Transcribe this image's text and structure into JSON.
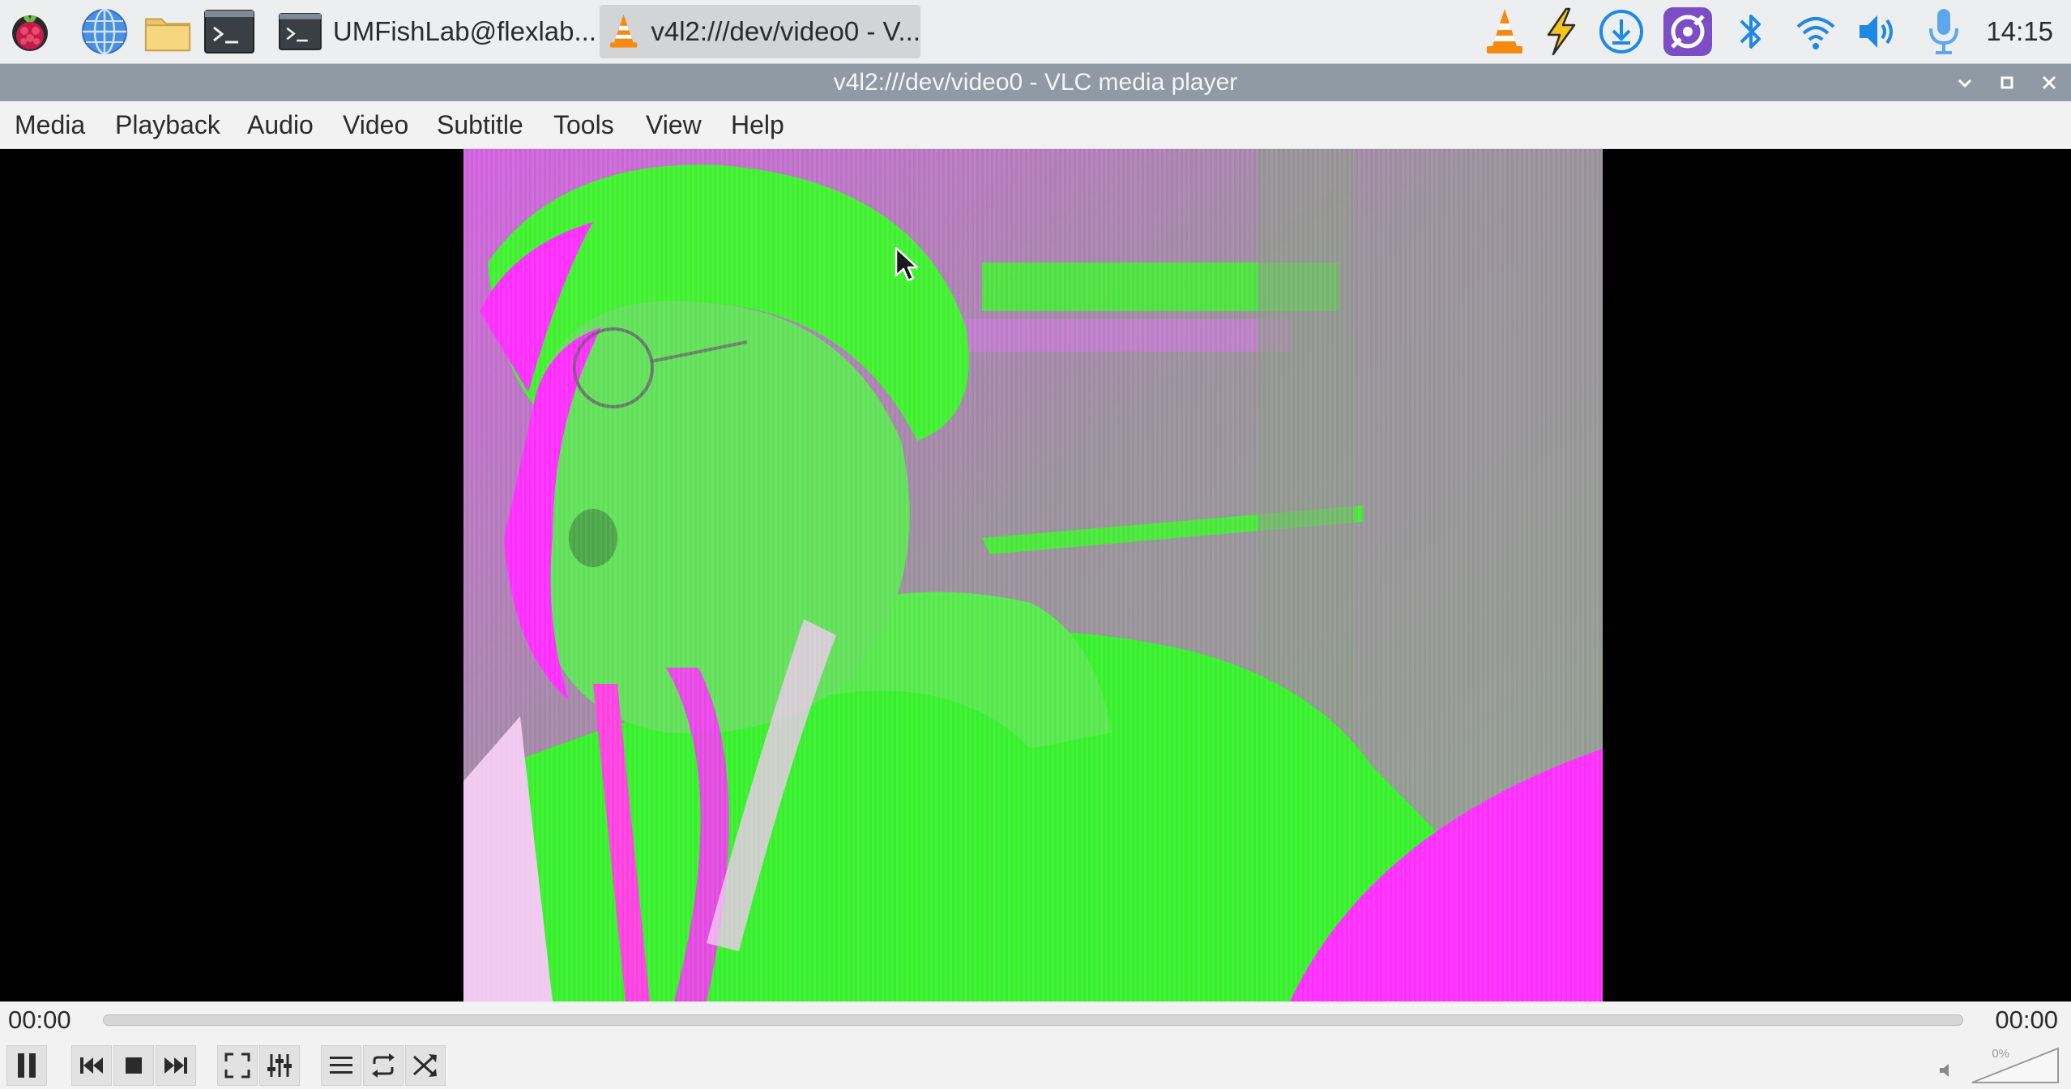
{
  "taskbar": {
    "launchers": [
      "raspberry-menu-icon",
      "web-browser-icon",
      "file-manager-icon",
      "terminal-icon"
    ],
    "tasks": [
      {
        "label": "UMFishLab@flexlab...",
        "icon": "terminal-icon",
        "active": false
      },
      {
        "label": "v4l2:///dev/video0 - V...",
        "icon": "vlc-cone-icon",
        "active": true
      }
    ],
    "tray": [
      "vlc-cone-icon",
      "lightning-bolt-icon",
      "download-icon",
      "vnc-icon",
      "bluetooth-icon",
      "wifi-icon",
      "speaker-icon",
      "microphone-icon"
    ],
    "clock": "14:15"
  },
  "window": {
    "title": "v4l2:///dev/video0 - VLC media player",
    "buttons": [
      "minimize-icon",
      "maximize-icon",
      "close-icon"
    ]
  },
  "menu": {
    "items": [
      "Media",
      "Playback",
      "Audio",
      "Video",
      "Subtitle",
      "Tools",
      "View",
      "Help"
    ]
  },
  "player": {
    "time_elapsed": "00:00",
    "time_total": "00:00",
    "progress_fraction": 0.0,
    "volume_label": "0%",
    "volume_fraction": 0.0
  },
  "colors": {
    "taskbar_bg": "#edeeef",
    "titlebar_bg": "#8f9aa4",
    "menubar_bg": "#f2f2f2",
    "vlc_orange": "#f48a10",
    "tray_blue": "#1e88e5",
    "vnc_purple": "#7c4dc4",
    "video_green": "#2ef52e",
    "video_magenta": "#ff2cff"
  }
}
